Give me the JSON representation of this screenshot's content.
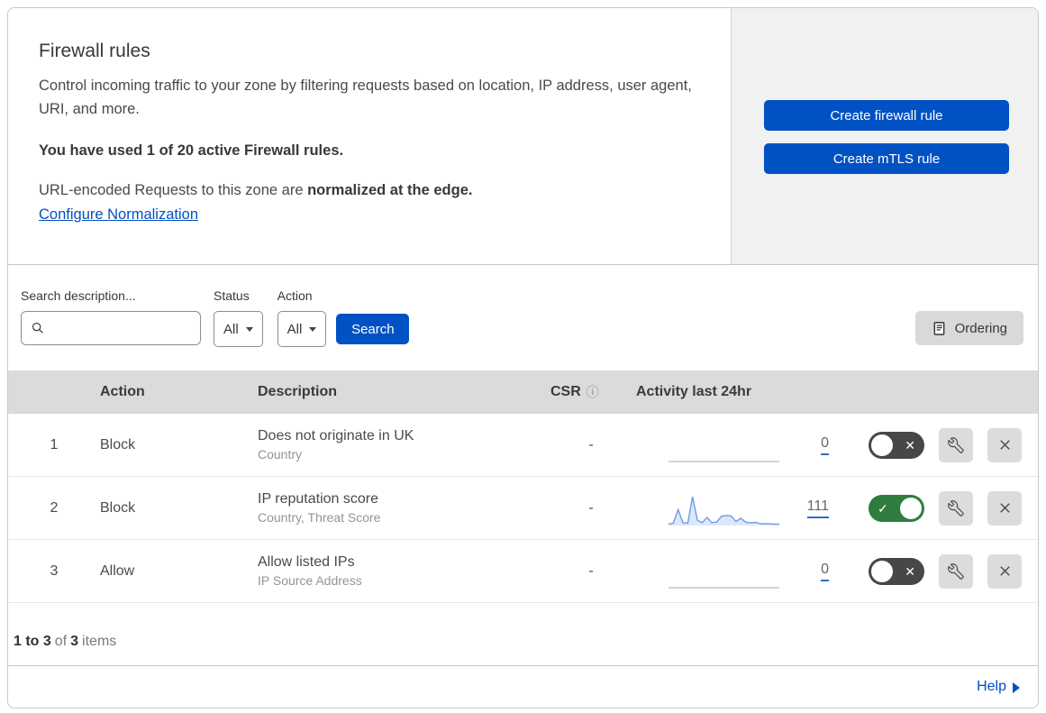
{
  "header": {
    "title": "Firewall rules",
    "description": "Control incoming traffic to your zone by filtering requests based on location, IP address, user agent, URI, and more.",
    "usage_bold": "You have used 1 of 20 active Firewall rules.",
    "normalization_prefix": "URL-encoded Requests to this zone are ",
    "normalization_bold": "normalized at the edge.",
    "normalization_link": "Configure Normalization",
    "create_firewall_button": "Create firewall rule",
    "create_mtls_button": "Create mTLS rule"
  },
  "filters": {
    "search_label": "Search description...",
    "search_value": "",
    "status_label": "Status",
    "status_value": "All",
    "action_label": "Action",
    "action_value": "All",
    "search_button": "Search",
    "ordering_button": "Ordering"
  },
  "table": {
    "columns": {
      "action": "Action",
      "description": "Description",
      "csr": "CSR",
      "activity": "Activity last 24hr"
    },
    "rows": [
      {
        "num": "1",
        "action": "Block",
        "description": "Does not originate in UK",
        "fields": "Country",
        "csr": "-",
        "count": "0",
        "enabled": false,
        "sparkline": [
          0,
          0
        ]
      },
      {
        "num": "2",
        "action": "Block",
        "description": "IP reputation score",
        "fields": "Country, Threat Score",
        "csr": "-",
        "count": "111",
        "enabled": true,
        "sparkline": [
          5,
          8,
          55,
          10,
          8,
          100,
          18,
          10,
          28,
          10,
          12,
          32,
          35,
          33,
          14,
          25,
          12,
          9,
          11,
          7,
          6,
          6,
          5,
          5
        ]
      },
      {
        "num": "3",
        "action": "Allow",
        "description": "Allow listed IPs",
        "fields": "IP Source Address",
        "csr": "-",
        "count": "0",
        "enabled": false,
        "sparkline": [
          0,
          0
        ]
      }
    ]
  },
  "footer": {
    "range_bold": "1 to 3",
    "of_text": "of",
    "total_bold": "3",
    "items_text": "items",
    "help_label": "Help"
  },
  "icons": {
    "check": "✓",
    "cross": "✕",
    "info": "ⓘ"
  },
  "colors": {
    "accent_blue": "#0051c3",
    "toggle_on_green": "#2e7d3e",
    "toggle_off_gray": "#474747",
    "sparkline_blue": "#6d9bea",
    "sparkline_fill": "#dce7f9",
    "header_gray": "#dbdbdb",
    "panel_gray": "#f1f1f1"
  }
}
